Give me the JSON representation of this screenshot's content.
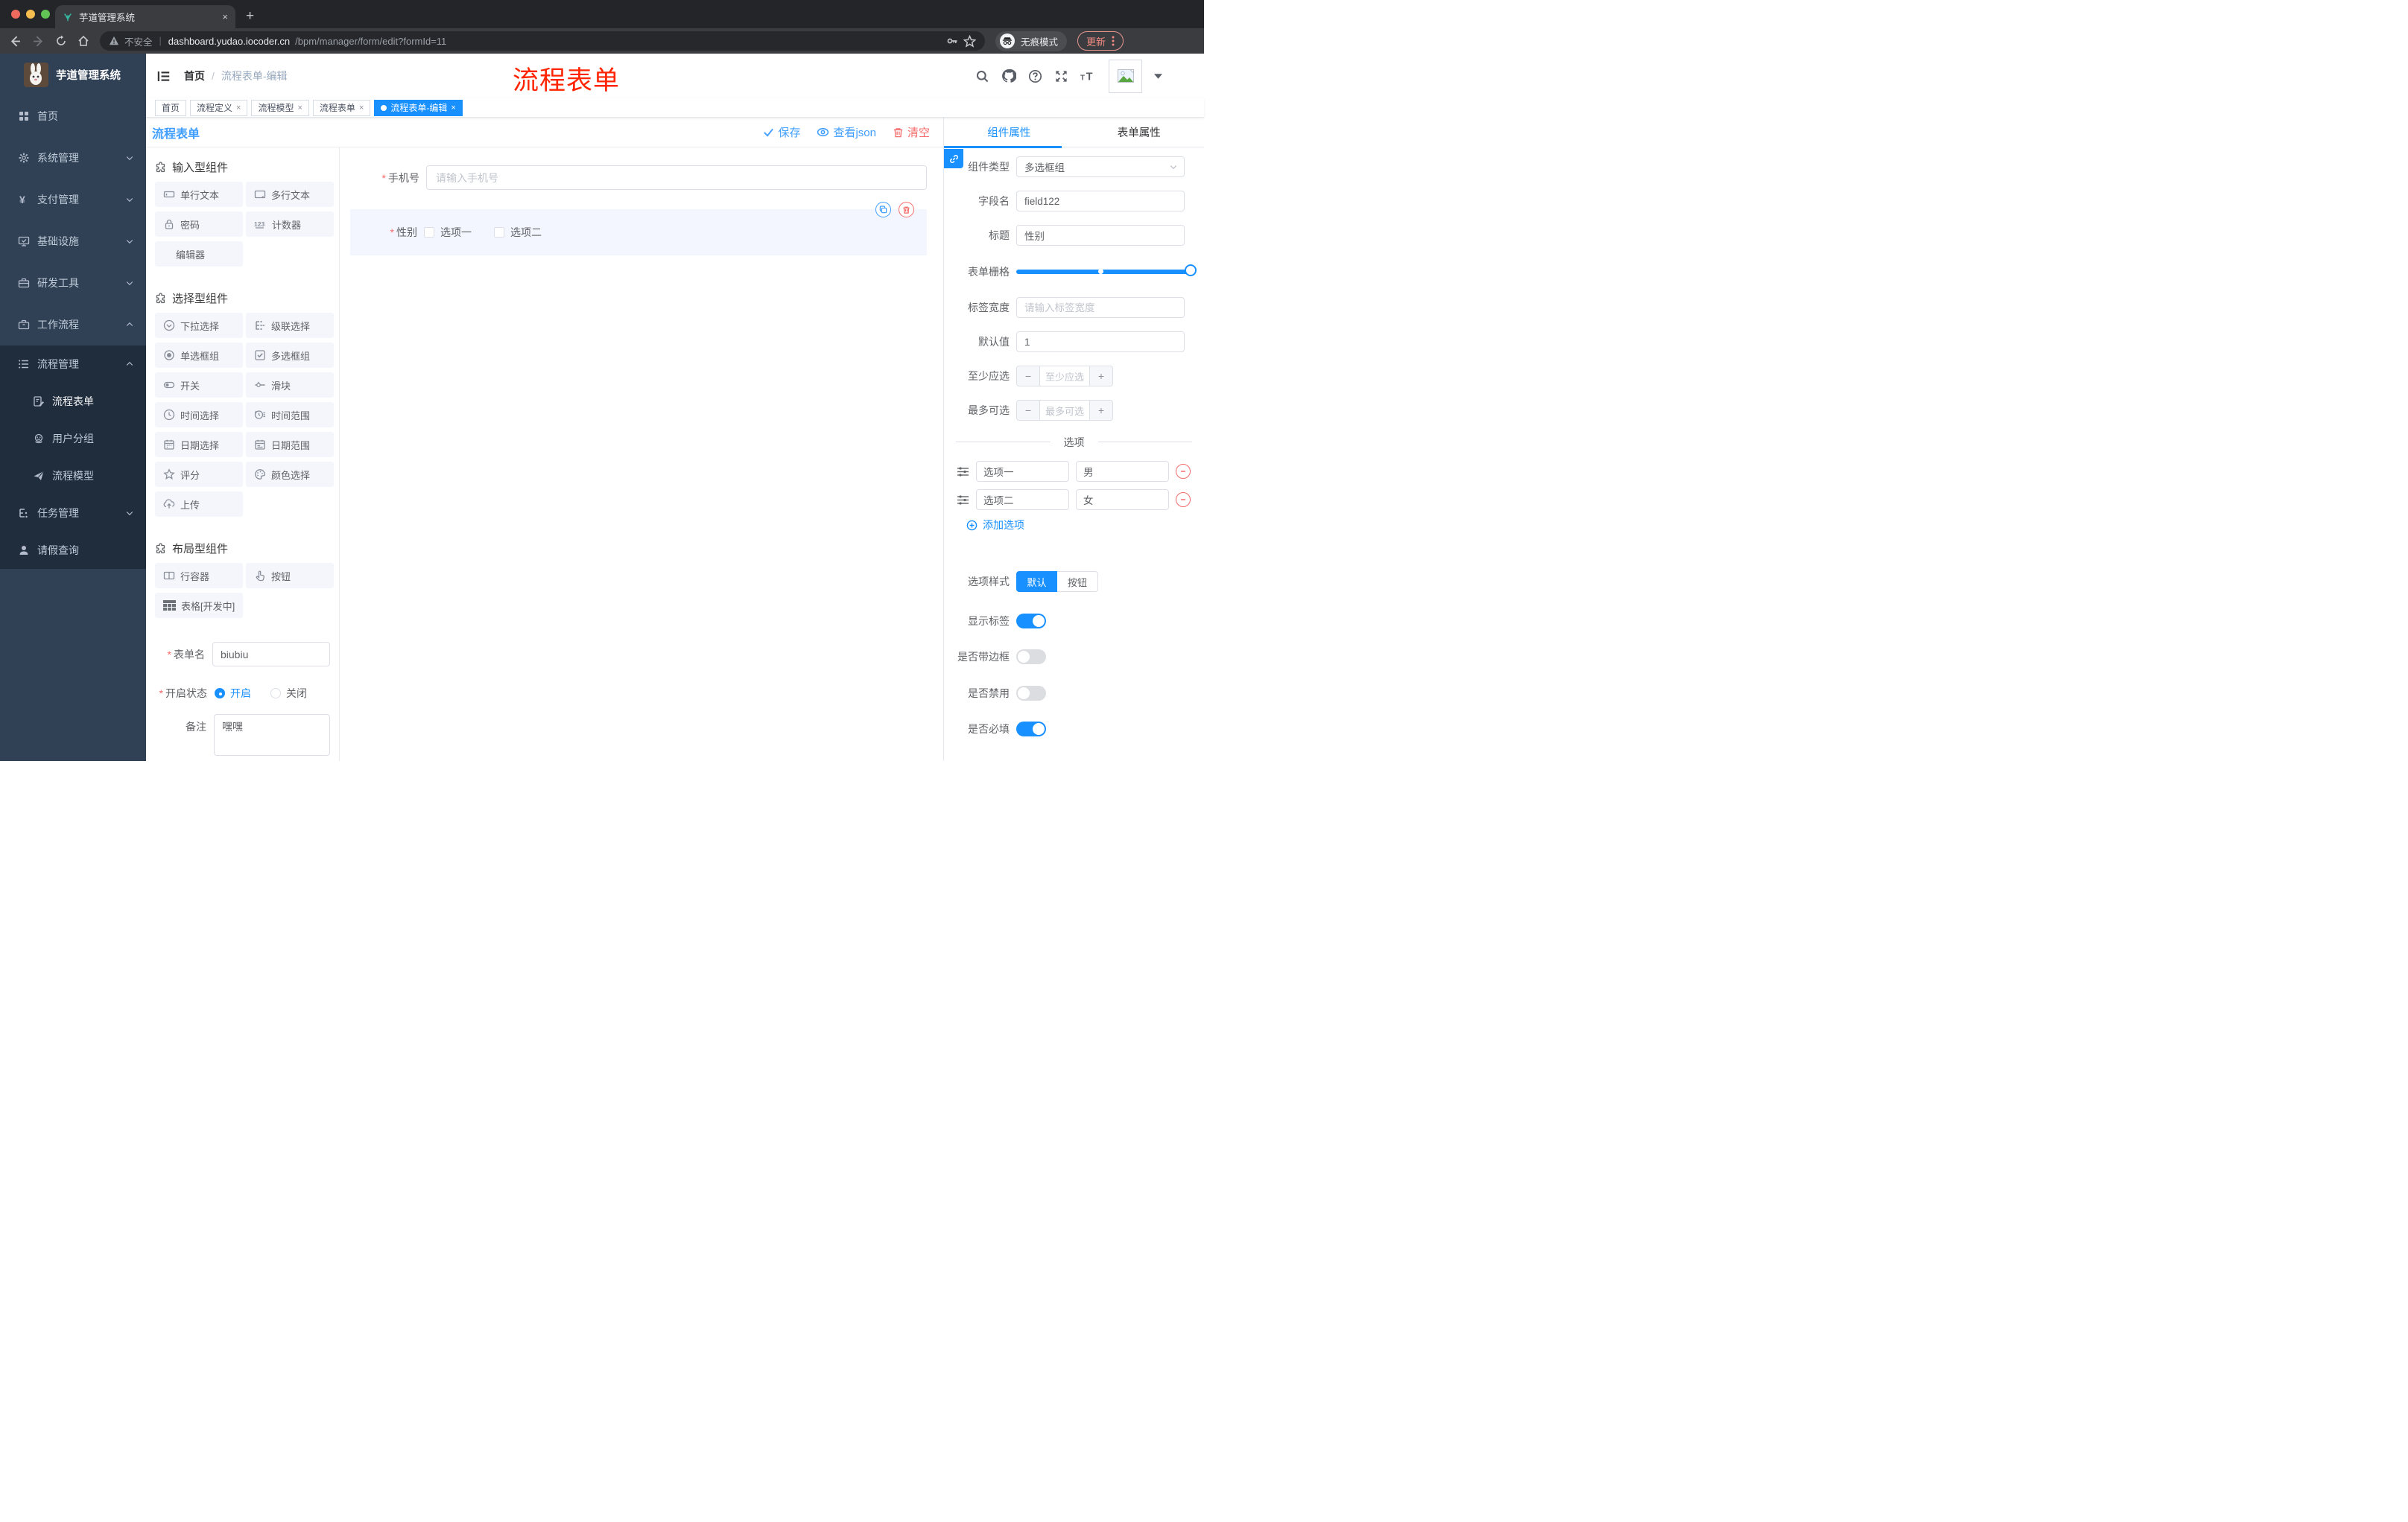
{
  "browser": {
    "tab_title": "芋道管理系统",
    "close_tab": "×",
    "security_label": "不安全",
    "url_domain": "dashboard.yudao.iocoder.cn",
    "url_path": "/bpm/manager/form/edit?formId=11",
    "incognito_label": "无痕模式",
    "update_label": "更新"
  },
  "sidebar": {
    "app_title": "芋道管理系统",
    "items": [
      {
        "label": "首页",
        "icon": "dashboard",
        "level": 1,
        "chevron": null,
        "dark": false,
        "current": false
      },
      {
        "label": "系统管理",
        "icon": "gear",
        "level": 1,
        "chevron": "down",
        "dark": false,
        "current": false
      },
      {
        "label": "支付管理",
        "icon": "yen",
        "level": 1,
        "chevron": "down",
        "dark": false,
        "current": false
      },
      {
        "label": "基础设施",
        "icon": "monitor",
        "level": 1,
        "chevron": "down",
        "dark": false,
        "current": false
      },
      {
        "label": "研发工具",
        "icon": "toolbox",
        "level": 1,
        "chevron": "down",
        "dark": false,
        "current": false
      },
      {
        "label": "工作流程",
        "icon": "briefcase",
        "level": 1,
        "chevron": "up",
        "dark": false,
        "current": false
      },
      {
        "label": "流程管理",
        "icon": "list",
        "level": 2,
        "chevron": "up",
        "dark": true,
        "current": false
      },
      {
        "label": "流程表单",
        "icon": "form-edit",
        "level": 3,
        "chevron": null,
        "dark": true,
        "current": true
      },
      {
        "label": "用户分组",
        "icon": "group",
        "level": 3,
        "chevron": null,
        "dark": true,
        "current": false
      },
      {
        "label": "流程模型",
        "icon": "plane",
        "level": 3,
        "chevron": null,
        "dark": true,
        "current": false
      },
      {
        "label": "任务管理",
        "icon": "flow",
        "level": 2,
        "chevron": "down",
        "dark": true,
        "current": false
      },
      {
        "label": "请假查询",
        "icon": "user",
        "level": 2,
        "chevron": null,
        "dark": true,
        "current": false
      }
    ]
  },
  "header": {
    "breadcrumb_home": "首页",
    "breadcrumb_sep": "/",
    "breadcrumb_current": "流程表单-编辑",
    "annotation": "流程表单"
  },
  "tags": [
    {
      "label": "首页",
      "closable": false,
      "active": false
    },
    {
      "label": "流程定义",
      "closable": true,
      "active": false
    },
    {
      "label": "流程模型",
      "closable": true,
      "active": false
    },
    {
      "label": "流程表单",
      "closable": true,
      "active": false
    },
    {
      "label": "流程表单-编辑",
      "closable": true,
      "active": true
    }
  ],
  "toolbar": {
    "title": "流程表单",
    "save_label": "保存",
    "view_json_label": "查看json",
    "clear_label": "清空"
  },
  "palette": {
    "sections": [
      {
        "title": "输入型组件",
        "items": [
          {
            "label": "单行文本",
            "icon": "input"
          },
          {
            "label": "多行文本",
            "icon": "textarea"
          },
          {
            "label": "密码",
            "icon": "lock"
          },
          {
            "label": "计数器",
            "icon": "counter"
          },
          {
            "label": "编辑器",
            "icon": null
          }
        ]
      },
      {
        "title": "选择型组件",
        "items": [
          {
            "label": "下拉选择",
            "icon": "select"
          },
          {
            "label": "级联选择",
            "icon": "cascader"
          },
          {
            "label": "单选框组",
            "icon": "radio"
          },
          {
            "label": "多选框组",
            "icon": "checkbox"
          },
          {
            "label": "开关",
            "icon": "switch"
          },
          {
            "label": "滑块",
            "icon": "slider"
          },
          {
            "label": "时间选择",
            "icon": "time"
          },
          {
            "label": "时间范围",
            "icon": "time-range"
          },
          {
            "label": "日期选择",
            "icon": "date"
          },
          {
            "label": "日期范围",
            "icon": "date-range"
          },
          {
            "label": "评分",
            "icon": "star"
          },
          {
            "label": "颜色选择",
            "icon": "palette"
          },
          {
            "label": "上传",
            "icon": "upload"
          }
        ]
      },
      {
        "title": "布局型组件",
        "items": [
          {
            "label": "行容器",
            "icon": "row"
          },
          {
            "label": "按钮",
            "icon": "pointer"
          },
          {
            "label": "表格[开发中]",
            "icon": "table"
          }
        ]
      }
    ]
  },
  "left_form": {
    "form_name_label": "表单名",
    "form_name_value": "biubiu",
    "status_label": "开启状态",
    "status_on": "开启",
    "status_off": "关闭",
    "remark_label": "备注",
    "remark_value": "嘿嘿"
  },
  "canvas": {
    "phone_label": "手机号",
    "phone_placeholder": "请输入手机号",
    "gender_label": "性别",
    "gender_options": [
      "选项一",
      "选项二"
    ]
  },
  "props": {
    "tab_component": "组件属性",
    "tab_form": "表单属性",
    "component_type_label": "组件类型",
    "component_type_value": "多选框组",
    "field_name_label": "字段名",
    "field_name_value": "field122",
    "title_label": "标题",
    "title_value": "性别",
    "grid_label": "表单栅格",
    "label_width_label": "标签宽度",
    "label_width_placeholder": "请输入标签宽度",
    "default_label": "默认值",
    "default_value": "1",
    "min_label": "至少应选",
    "min_placeholder": "至少应选",
    "max_label": "最多可选",
    "max_placeholder": "最多可选",
    "options_divider": "选项",
    "options": [
      {
        "text": "选项一",
        "value": "男"
      },
      {
        "text": "选项二",
        "value": "女"
      }
    ],
    "add_option_label": "添加选项",
    "style_label": "选项样式",
    "style_options": [
      "默认",
      "按钮"
    ],
    "style_active": "默认",
    "toggles": [
      {
        "label": "显示标签",
        "on": true
      },
      {
        "label": "是否带边框",
        "on": false
      },
      {
        "label": "是否禁用",
        "on": false
      },
      {
        "label": "是否必填",
        "on": true
      }
    ]
  },
  "colors": {
    "primary": "#1890ff",
    "link_blue": "#409eff",
    "danger": "#f56c6c",
    "sidebar_bg": "#304156",
    "sidebar_sub_bg": "#1f2d3d",
    "palette_item_bg": "#f4f6fc",
    "selected_block_bg": "#f4f6ff",
    "annotation_red": "#ff2400"
  }
}
